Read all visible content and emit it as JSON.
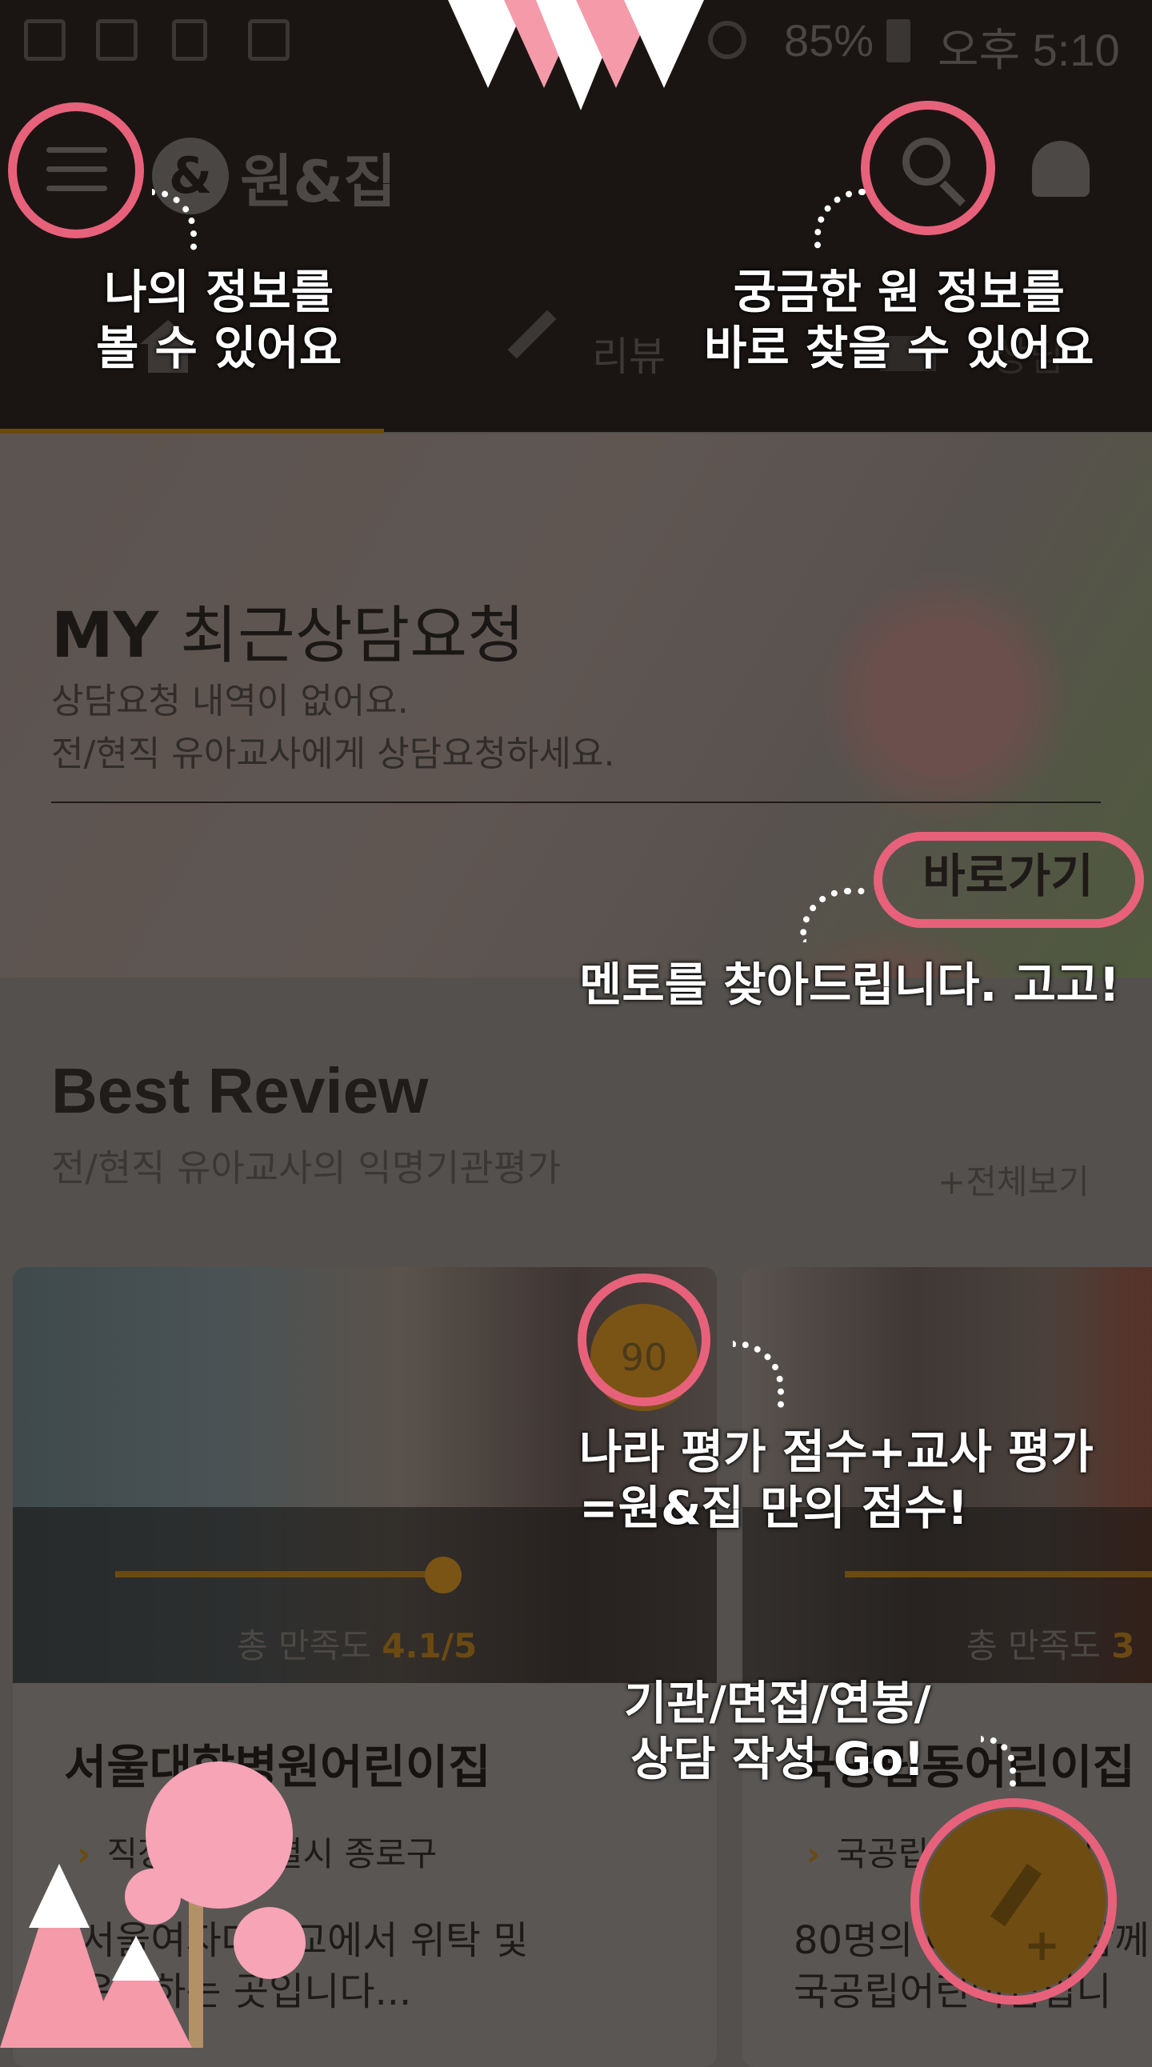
{
  "status_bar": {
    "battery": "85%",
    "time": "오후 5:10"
  },
  "app_bar": {
    "logo_mark": "&",
    "logo_text": "원&집",
    "tabs": [
      {
        "label": "홈"
      },
      {
        "label": "리뷰"
      },
      {
        "label": "상담"
      }
    ]
  },
  "hero": {
    "title_bold": "MY",
    "title_rest": "최근상담요청",
    "line1": "상담요청 내역이 없어요.",
    "line2": "전/현직 유아교사에게 상담요청하세요.",
    "button": "바로가기"
  },
  "best_review": {
    "title": "Best Review",
    "subtitle": "전/현직 유아교사의 익명기관평가",
    "see_all": "+전체보기",
    "score_badge": "90",
    "cards": [
      {
        "satisfaction_label": "총 만족도",
        "satisfaction_value": "4.1/5",
        "satisfaction_fraction": 0.82,
        "name": "서울대학병원어린이집",
        "location": "직장 서울특별시 종로구",
        "desc1": "서울여자대학교에서 위탁 및",
        "desc2": "운영하는 곳입니다..."
      },
      {
        "satisfaction_label": "총 만족도",
        "satisfaction_value": "3",
        "satisfaction_fraction": 0.95,
        "name": "국공립동어린이집",
        "location": "국공립 서울특별시",
        "desc1": "80명의 아이들과 함께",
        "desc2": "국공립어린이집입니"
      }
    ]
  },
  "annotations": {
    "menu_note_1": "나의 정보를",
    "menu_note_2": "볼 수 있어요",
    "search_note_1": "궁금한 원 정보를",
    "search_note_2": "바로 찾을 수 있어요",
    "shortcut_note": "멘토를 찾아드립니다. 고고!",
    "score_note_1": "나라 평가 점수+교사 평가",
    "score_note_2": "=원&집 만의 점수!",
    "fab_note_1": "기관/면접/연봉/",
    "fab_note_2": "상담 작성 Go!"
  },
  "colors": {
    "accent": "#f5a623",
    "annotation_ring": "#e8617a",
    "app_bar": "#1a1513"
  }
}
